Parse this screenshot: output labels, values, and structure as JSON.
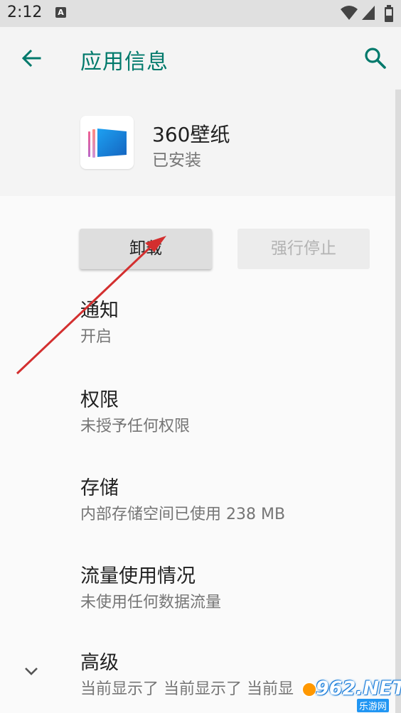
{
  "status_bar": {
    "time": "2:12",
    "notification_icon_letter": "A",
    "icons": [
      "wifi-icon",
      "signal-icon",
      "battery-icon"
    ]
  },
  "app_bar": {
    "title": "应用信息",
    "back_icon": "arrow-back-icon",
    "search_icon": "search-icon",
    "accent_color": "#00796b"
  },
  "app_header": {
    "name": "360壁纸",
    "status": "已安装"
  },
  "buttons": {
    "uninstall": "卸载",
    "force_stop": "强行停止"
  },
  "settings": [
    {
      "title": "通知",
      "summary": "开启"
    },
    {
      "title": "权限",
      "summary": "未授予任何权限"
    },
    {
      "title": "存储",
      "summary": "内部存储空间已使用 238 MB"
    },
    {
      "title": "流量使用情况",
      "summary": "未使用任何数据流量"
    },
    {
      "title": "高级",
      "summary": "当前显示了 当前显示了 当前显"
    }
  ],
  "watermark": {
    "main": "962.NET",
    "sub": "乐游网"
  }
}
